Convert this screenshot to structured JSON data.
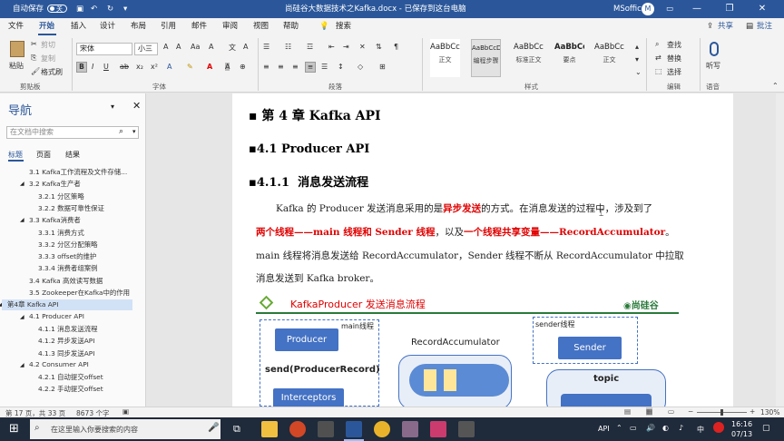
{
  "titlebar": {
    "autosave_label": "自动保存",
    "autosave_state": "关",
    "doc_title": "尚硅谷大数据技术之Kafka.docx - 已保存到这台电脑",
    "user": "MSoffice",
    "avatar_letter": "M"
  },
  "tabs": [
    "文件",
    "开始",
    "插入",
    "设计",
    "布局",
    "引用",
    "邮件",
    "审阅",
    "视图",
    "帮助"
  ],
  "active_tab": "开始",
  "search_tell": "搜索",
  "share_label": "共享",
  "comment_label": "批注",
  "ribbon": {
    "clipboard": {
      "paste": "粘贴",
      "cut": "剪切",
      "copy": "复制",
      "format_painter": "格式刷",
      "group": "剪贴板"
    },
    "font": {
      "name": "宋体",
      "size": "小三",
      "group": "字体"
    },
    "paragraph": {
      "group": "段落"
    },
    "styles": {
      "group": "样式",
      "items": [
        {
          "preview": "AaBbCcI",
          "name": "正文"
        },
        {
          "preview": "AaBbCcDd",
          "name": "编程步骤"
        },
        {
          "preview": "AaBbCcDc",
          "name": "标准正文"
        },
        {
          "preview": "AaBbCcD",
          "name": "要点"
        },
        {
          "preview": "AaBbCcDc",
          "name": "正文"
        }
      ]
    },
    "editing": {
      "find": "查找",
      "replace": "替换",
      "select": "选择",
      "group": "编辑"
    },
    "voice": {
      "dictate": "听写",
      "group": "语音"
    }
  },
  "nav": {
    "title": "导航",
    "search_placeholder": "在文档中搜索",
    "tabs": [
      "标题",
      "页面",
      "结果"
    ],
    "items": [
      {
        "label": "3.1 Kafka工作流程及文件存储...",
        "level": 2
      },
      {
        "label": "3.2 Kafka生产者",
        "level": 2
      },
      {
        "label": "3.2.1 分区策略",
        "level": 3
      },
      {
        "label": "3.2.2 数据可靠性保证",
        "level": 3
      },
      {
        "label": "3.3 Kafka消费者",
        "level": 2
      },
      {
        "label": "3.3.1 消费方式",
        "level": 3
      },
      {
        "label": "3.3.2 分区分配策略",
        "level": 3
      },
      {
        "label": "3.3.3 offset的维护",
        "level": 3
      },
      {
        "label": "3.3.4 消费者组案例",
        "level": 3
      },
      {
        "label": "3.4 Kafka 高效读写数据",
        "level": 2
      },
      {
        "label": "3.5 Zookeeper在Kafka中的作用",
        "level": 2
      },
      {
        "label": "第4章 Kafka API",
        "level": 1
      },
      {
        "label": "4.1 Producer API",
        "level": 2
      },
      {
        "label": "4.1.1 消息发送流程",
        "level": 3
      },
      {
        "label": "4.1.2 异步发送API",
        "level": 3
      },
      {
        "label": "4.1.3 同步发送API",
        "level": 3
      },
      {
        "label": "4.2 Consumer API",
        "level": 2
      },
      {
        "label": "4.2.1 自动提交offset",
        "level": 3
      },
      {
        "label": "4.2.2 手动提交offset",
        "level": 3
      }
    ]
  },
  "doc": {
    "h1": "第 4 章  Kafka API",
    "h2": "4.1 Producer API",
    "h3_num": "4.1.1",
    "h3_text": "消息发送流程",
    "p1_a": "Kafka 的 Producer 发送消息采用的是",
    "p1_b": "异步发送",
    "p1_c": "的方式。在消息发送的过程中，涉及到了",
    "p2_a": "两个线程——main 线程和 Sender 线程",
    "p2_b": "，以及",
    "p2_c": "一个线程共享变量——RecordAccumulator",
    "p2_d": "。",
    "p3": "main 线程将消息发送给 RecordAccumulator，Sender 线程不断从 RecordAccumulator 中拉取",
    "p4": "消息发送到 Kafka broker。"
  },
  "diagram": {
    "title": "KafkaProducer 发送消息流程",
    "brand": "尚硅谷",
    "main_thread": "main线程",
    "producer": "Producer",
    "send": "send(ProducerRecord)",
    "interceptors": "Interceptors",
    "record_acc": "RecordAccumulator",
    "sender_thread": "sender线程",
    "sender": "Sender",
    "topic": "topic"
  },
  "status": {
    "page": "第 17 页，共 33 页",
    "words": "8673 个字",
    "zoom": "130%"
  },
  "taskbar": {
    "search_placeholder": "在这里输入你要搜索的内容",
    "tray_text": "API",
    "ime": "中",
    "time": "16:16",
    "date": "07/13"
  },
  "colors": {
    "word_blue": "#2b579a",
    "red_text": "#e00000",
    "diagram_blue": "#4472c4"
  }
}
